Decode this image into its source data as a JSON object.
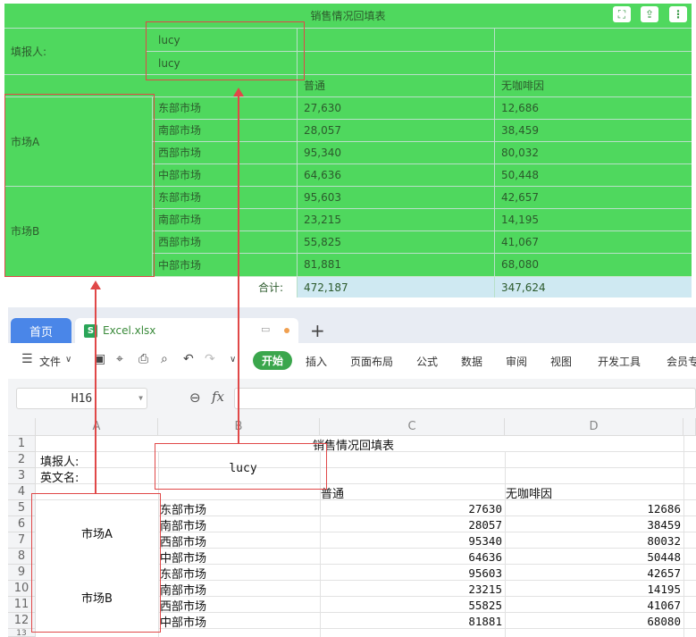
{
  "report": {
    "title": "销售情况回填表",
    "filler_label": "填报人:",
    "filler_values": [
      "lucy",
      "lucy"
    ],
    "col_headers": [
      "普通",
      "无咖啡因"
    ],
    "groups": [
      {
        "name": "市场A",
        "rows": [
          {
            "region": "东部市场",
            "regular": "27,630",
            "decaf": "12,686"
          },
          {
            "region": "南部市场",
            "regular": "28,057",
            "decaf": "38,459"
          },
          {
            "region": "西部市场",
            "regular": "95,340",
            "decaf": "80,032"
          },
          {
            "region": "中部市场",
            "regular": "64,636",
            "decaf": "50,448"
          }
        ]
      },
      {
        "name": "市场B",
        "rows": [
          {
            "region": "东部市场",
            "regular": "95,603",
            "decaf": "42,657"
          },
          {
            "region": "南部市场",
            "regular": "23,215",
            "decaf": "14,195"
          },
          {
            "region": "西部市场",
            "regular": "55,825",
            "decaf": "41,067"
          },
          {
            "region": "中部市场",
            "regular": "81,881",
            "decaf": "68,080"
          }
        ]
      }
    ],
    "total_label": "合计:",
    "total_regular": "472,187",
    "total_decaf": "347,624",
    "icons": [
      "fullscreen-icon",
      "export-icon",
      "more-icon"
    ]
  },
  "wps": {
    "tabs": {
      "home": "首页",
      "file": "Excel.xlsx",
      "plus": "+"
    },
    "ribbon": {
      "menu": "文件",
      "start": "开始",
      "items": [
        "插入",
        "页面布局",
        "公式",
        "数据",
        "审阅",
        "视图",
        "开发工具",
        "会员专"
      ]
    },
    "namebox": "H16",
    "fx": "fx",
    "columns": [
      "A",
      "B",
      "C",
      "D"
    ],
    "row_numbers": [
      "1",
      "2",
      "3",
      "4",
      "5",
      "6",
      "7",
      "8",
      "9",
      "10",
      "11",
      "12",
      "13"
    ],
    "sheet": {
      "title": "销售情况回填表",
      "filler_label": "填报人:",
      "english_label": "英文名:",
      "filler_value": "lucy",
      "col_regular": "普通",
      "col_decaf": "无咖啡因",
      "group_a": "市场A",
      "group_b": "市场B",
      "regions": [
        "东部市场",
        "南部市场",
        "西部市场",
        "中部市场",
        "东部市场",
        "南部市场",
        "西部市场",
        "中部市场"
      ],
      "regular": [
        "27630",
        "28057",
        "95340",
        "64636",
        "95603",
        "23215",
        "55825",
        "81881"
      ],
      "decaf": [
        "12686",
        "38459",
        "80032",
        "50448",
        "42657",
        "14195",
        "41067",
        "68080"
      ]
    }
  },
  "colors": {
    "report_bg": "#4fd85e",
    "accent_red": "#e04848",
    "start_green": "#3aa64c",
    "home_tab": "#4a86e8"
  }
}
